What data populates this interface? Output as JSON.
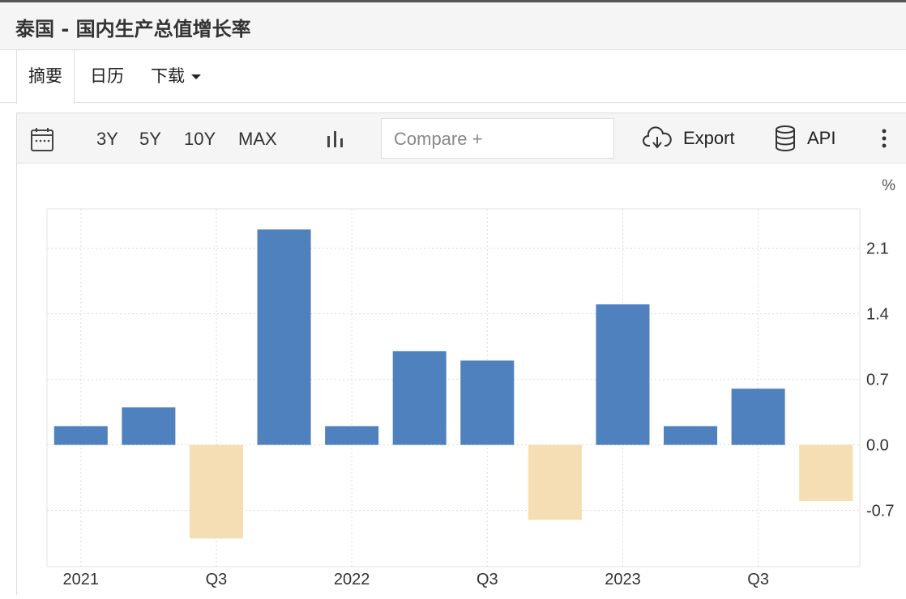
{
  "page": {
    "title": "泰国 - 国内生产总值增长率"
  },
  "tabs": [
    {
      "label": "摘要",
      "active": true
    },
    {
      "label": "日历",
      "active": false
    },
    {
      "label": "下载",
      "active": false,
      "dropdown": true
    }
  ],
  "toolbar": {
    "calendar_icon": "calendar-icon",
    "ranges": [
      "3Y",
      "5Y",
      "10Y",
      "MAX"
    ],
    "chart_type_icon": "bar-chart-icon",
    "compare_placeholder": "Compare +",
    "export_label": "Export",
    "export_icon": "cloud-download-icon",
    "api_label": "API",
    "api_icon": "database-icon",
    "more_icon": "more-vertical-icon"
  },
  "chart_data": {
    "type": "bar",
    "unit_label": "%",
    "categories": [
      "2021 Q1",
      "2021 Q2",
      "2021 Q3",
      "2021 Q4",
      "2022 Q1",
      "2022 Q2",
      "2022 Q3",
      "2022 Q4",
      "2023 Q1",
      "2023 Q2",
      "2023 Q3",
      "2023 Q4"
    ],
    "values": [
      0.2,
      0.4,
      -1.0,
      2.3,
      0.2,
      1.0,
      0.9,
      -0.8,
      1.5,
      0.2,
      0.6,
      -0.6
    ],
    "x_tick_labels": [
      {
        "category": "2021 Q1",
        "label": "2021"
      },
      {
        "category": "2021 Q3",
        "label": "Q3"
      },
      {
        "category": "2022 Q1",
        "label": "2022"
      },
      {
        "category": "2022 Q3",
        "label": "Q3"
      },
      {
        "category": "2023 Q1",
        "label": "2023"
      },
      {
        "category": "2023 Q3",
        "label": "Q3"
      }
    ],
    "y_ticks": [
      2.1,
      1.4,
      0.7,
      0.0,
      -0.7
    ],
    "y_tick_labels": [
      "2.1",
      "1.4",
      "0.7",
      "0.0",
      "-0.7"
    ],
    "ylim": [
      -1.3,
      2.52
    ],
    "y_axis_side": "right",
    "grid": true,
    "colors": {
      "positive": "#4e81bd",
      "negative": "#f5deb3"
    }
  }
}
